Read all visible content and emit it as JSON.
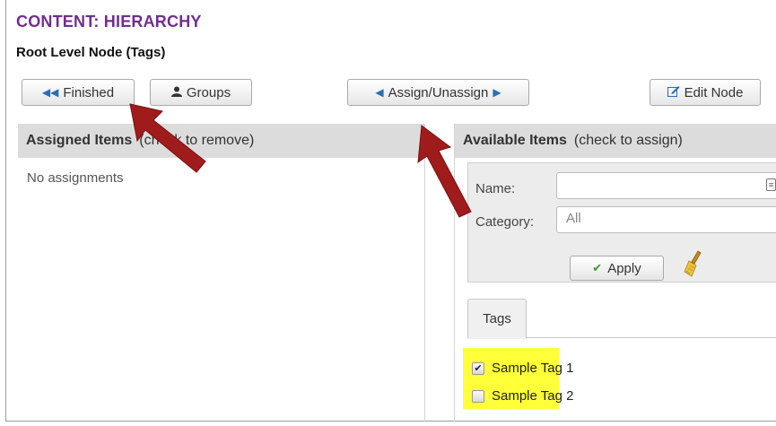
{
  "header": {
    "title": "CONTENT: HIERARCHY",
    "subtitle": "Root Level Node (Tags)"
  },
  "toolbar": {
    "finished_label": "Finished",
    "groups_label": "Groups",
    "assign_label": "Assign/Unassign",
    "edit_label": "Edit Node"
  },
  "assigned": {
    "title": "Assigned Items",
    "hint": "(check to remove)",
    "empty_text": "No assignments"
  },
  "available": {
    "title": "Available Items",
    "hint": "(check to assign)",
    "name_label": "Name:",
    "name_value": "",
    "category_label": "Category:",
    "category_value": "All",
    "apply_label": "Apply",
    "tab_label": "Tags",
    "items": [
      {
        "label": "Sample Tag 1",
        "checked": true
      },
      {
        "label": "Sample Tag 2",
        "checked": false
      }
    ]
  },
  "colors": {
    "title": "#6f2f8f",
    "highlight": "#ffff3a",
    "arrow": "#a01c1c",
    "icon_blue": "#2a6fb5"
  },
  "icons": {
    "finished": "double-chevron-left-icon",
    "groups": "user-icon",
    "assign_left": "caret-left-icon",
    "assign_right": "caret-right-icon",
    "edit": "edit-icon",
    "apply": "checkmark-icon",
    "clear": "broom-icon"
  }
}
